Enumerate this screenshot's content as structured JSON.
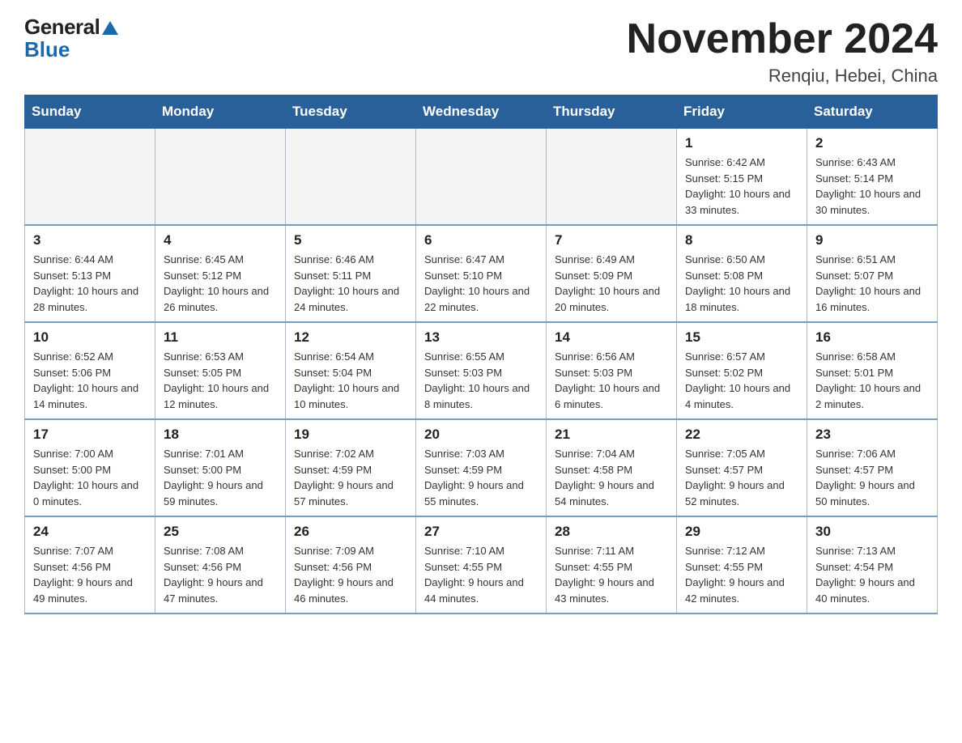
{
  "logo": {
    "general": "General",
    "blue": "Blue"
  },
  "header": {
    "month_year": "November 2024",
    "location": "Renqiu, Hebei, China"
  },
  "weekdays": [
    "Sunday",
    "Monday",
    "Tuesday",
    "Wednesday",
    "Thursday",
    "Friday",
    "Saturday"
  ],
  "weeks": [
    [
      {
        "day": "",
        "info": ""
      },
      {
        "day": "",
        "info": ""
      },
      {
        "day": "",
        "info": ""
      },
      {
        "day": "",
        "info": ""
      },
      {
        "day": "",
        "info": ""
      },
      {
        "day": "1",
        "info": "Sunrise: 6:42 AM\nSunset: 5:15 PM\nDaylight: 10 hours and 33 minutes."
      },
      {
        "day": "2",
        "info": "Sunrise: 6:43 AM\nSunset: 5:14 PM\nDaylight: 10 hours and 30 minutes."
      }
    ],
    [
      {
        "day": "3",
        "info": "Sunrise: 6:44 AM\nSunset: 5:13 PM\nDaylight: 10 hours and 28 minutes."
      },
      {
        "day": "4",
        "info": "Sunrise: 6:45 AM\nSunset: 5:12 PM\nDaylight: 10 hours and 26 minutes."
      },
      {
        "day": "5",
        "info": "Sunrise: 6:46 AM\nSunset: 5:11 PM\nDaylight: 10 hours and 24 minutes."
      },
      {
        "day": "6",
        "info": "Sunrise: 6:47 AM\nSunset: 5:10 PM\nDaylight: 10 hours and 22 minutes."
      },
      {
        "day": "7",
        "info": "Sunrise: 6:49 AM\nSunset: 5:09 PM\nDaylight: 10 hours and 20 minutes."
      },
      {
        "day": "8",
        "info": "Sunrise: 6:50 AM\nSunset: 5:08 PM\nDaylight: 10 hours and 18 minutes."
      },
      {
        "day": "9",
        "info": "Sunrise: 6:51 AM\nSunset: 5:07 PM\nDaylight: 10 hours and 16 minutes."
      }
    ],
    [
      {
        "day": "10",
        "info": "Sunrise: 6:52 AM\nSunset: 5:06 PM\nDaylight: 10 hours and 14 minutes."
      },
      {
        "day": "11",
        "info": "Sunrise: 6:53 AM\nSunset: 5:05 PM\nDaylight: 10 hours and 12 minutes."
      },
      {
        "day": "12",
        "info": "Sunrise: 6:54 AM\nSunset: 5:04 PM\nDaylight: 10 hours and 10 minutes."
      },
      {
        "day": "13",
        "info": "Sunrise: 6:55 AM\nSunset: 5:03 PM\nDaylight: 10 hours and 8 minutes."
      },
      {
        "day": "14",
        "info": "Sunrise: 6:56 AM\nSunset: 5:03 PM\nDaylight: 10 hours and 6 minutes."
      },
      {
        "day": "15",
        "info": "Sunrise: 6:57 AM\nSunset: 5:02 PM\nDaylight: 10 hours and 4 minutes."
      },
      {
        "day": "16",
        "info": "Sunrise: 6:58 AM\nSunset: 5:01 PM\nDaylight: 10 hours and 2 minutes."
      }
    ],
    [
      {
        "day": "17",
        "info": "Sunrise: 7:00 AM\nSunset: 5:00 PM\nDaylight: 10 hours and 0 minutes."
      },
      {
        "day": "18",
        "info": "Sunrise: 7:01 AM\nSunset: 5:00 PM\nDaylight: 9 hours and 59 minutes."
      },
      {
        "day": "19",
        "info": "Sunrise: 7:02 AM\nSunset: 4:59 PM\nDaylight: 9 hours and 57 minutes."
      },
      {
        "day": "20",
        "info": "Sunrise: 7:03 AM\nSunset: 4:59 PM\nDaylight: 9 hours and 55 minutes."
      },
      {
        "day": "21",
        "info": "Sunrise: 7:04 AM\nSunset: 4:58 PM\nDaylight: 9 hours and 54 minutes."
      },
      {
        "day": "22",
        "info": "Sunrise: 7:05 AM\nSunset: 4:57 PM\nDaylight: 9 hours and 52 minutes."
      },
      {
        "day": "23",
        "info": "Sunrise: 7:06 AM\nSunset: 4:57 PM\nDaylight: 9 hours and 50 minutes."
      }
    ],
    [
      {
        "day": "24",
        "info": "Sunrise: 7:07 AM\nSunset: 4:56 PM\nDaylight: 9 hours and 49 minutes."
      },
      {
        "day": "25",
        "info": "Sunrise: 7:08 AM\nSunset: 4:56 PM\nDaylight: 9 hours and 47 minutes."
      },
      {
        "day": "26",
        "info": "Sunrise: 7:09 AM\nSunset: 4:56 PM\nDaylight: 9 hours and 46 minutes."
      },
      {
        "day": "27",
        "info": "Sunrise: 7:10 AM\nSunset: 4:55 PM\nDaylight: 9 hours and 44 minutes."
      },
      {
        "day": "28",
        "info": "Sunrise: 7:11 AM\nSunset: 4:55 PM\nDaylight: 9 hours and 43 minutes."
      },
      {
        "day": "29",
        "info": "Sunrise: 7:12 AM\nSunset: 4:55 PM\nDaylight: 9 hours and 42 minutes."
      },
      {
        "day": "30",
        "info": "Sunrise: 7:13 AM\nSunset: 4:54 PM\nDaylight: 9 hours and 40 minutes."
      }
    ]
  ]
}
